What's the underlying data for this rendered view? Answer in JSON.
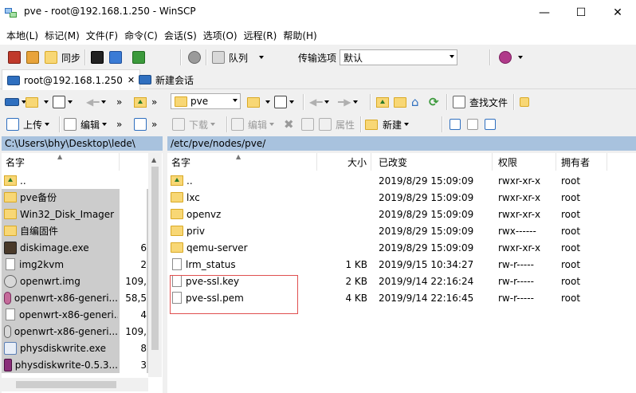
{
  "window": {
    "title": "pve - root@192.168.1.250 - WinSCP",
    "minimize": "—",
    "maximize": "☐",
    "close": "✕"
  },
  "menu": [
    "本地(L)",
    "标记(M)",
    "文件(F)",
    "命令(C)",
    "会话(S)",
    "选项(O)",
    "远程(R)",
    "帮助(H)"
  ],
  "toolbar1": {
    "sync_label": "同步",
    "queue_label": "队列",
    "transfer_options_label": "传输选项",
    "transfer_options_value": "默认"
  },
  "tabs": {
    "session": "root@192.168.1.250",
    "new_session": "新建会话"
  },
  "local_toolbar": {
    "upload": "上传",
    "edit": "编辑"
  },
  "remote_toolbar": {
    "dir": "pve",
    "find": "查找文件",
    "download": "下载",
    "edit": "编辑",
    "properties": "属性",
    "new": "新建"
  },
  "local": {
    "path": "C:\\Users\\bhy\\Desktop\\lede\\",
    "col_name": "名字",
    "files": [
      {
        "name": "..",
        "size": "",
        "type": "up"
      },
      {
        "name": "pve备份",
        "size": "",
        "type": "folder"
      },
      {
        "name": "Win32_Disk_Imager",
        "size": "",
        "type": "folder"
      },
      {
        "name": "自编固件",
        "size": "",
        "type": "folder"
      },
      {
        "name": "diskimage.exe",
        "size": "6",
        "type": "exe"
      },
      {
        "name": "img2kvm",
        "size": "2",
        "type": "file"
      },
      {
        "name": "openwrt.img",
        "size": "109,",
        "type": "disk"
      },
      {
        "name": "openwrt-x86-generi...",
        "size": "58,5",
        "type": "disc"
      },
      {
        "name": "openwrt-x86-generi...",
        "size": "4",
        "type": "file"
      },
      {
        "name": "openwrt-x86-generi...",
        "size": "109,",
        "type": "disk"
      },
      {
        "name": "physdiskwrite.exe",
        "size": "8",
        "type": "exe2"
      },
      {
        "name": "physdiskwrite-0.5.3...",
        "size": "3",
        "type": "rar"
      }
    ]
  },
  "remote": {
    "path": "/etc/pve/nodes/pve/",
    "columns": {
      "name": "名字",
      "size": "大小",
      "changed": "已改变",
      "rights": "权限",
      "owner": "拥有者"
    },
    "files": [
      {
        "name": "..",
        "size": "",
        "changed": "2019/8/29 15:09:09",
        "rights": "rwxr-xr-x",
        "owner": "root",
        "type": "up"
      },
      {
        "name": "lxc",
        "size": "",
        "changed": "2019/8/29 15:09:09",
        "rights": "rwxr-xr-x",
        "owner": "root",
        "type": "folder"
      },
      {
        "name": "openvz",
        "size": "",
        "changed": "2019/8/29 15:09:09",
        "rights": "rwxr-xr-x",
        "owner": "root",
        "type": "folder"
      },
      {
        "name": "priv",
        "size": "",
        "changed": "2019/8/29 15:09:09",
        "rights": "rwx------",
        "owner": "root",
        "type": "folder"
      },
      {
        "name": "qemu-server",
        "size": "",
        "changed": "2019/8/29 15:09:09",
        "rights": "rwxr-xr-x",
        "owner": "root",
        "type": "folder"
      },
      {
        "name": "lrm_status",
        "size": "1 KB",
        "changed": "2019/9/15 10:34:27",
        "rights": "rw-r-----",
        "owner": "root",
        "type": "file"
      },
      {
        "name": "pve-ssl.key",
        "size": "2 KB",
        "changed": "2019/9/14 22:16:24",
        "rights": "rw-r-----",
        "owner": "root",
        "type": "file"
      },
      {
        "name": "pve-ssl.pem",
        "size": "4 KB",
        "changed": "2019/9/14 22:16:45",
        "rights": "rw-r-----",
        "owner": "root",
        "type": "file"
      }
    ]
  },
  "colors": {
    "path_bar": "#a8c2de",
    "selected_row": "#cccccc",
    "highlight_box": "#e05050",
    "folder": "#f8d775"
  }
}
